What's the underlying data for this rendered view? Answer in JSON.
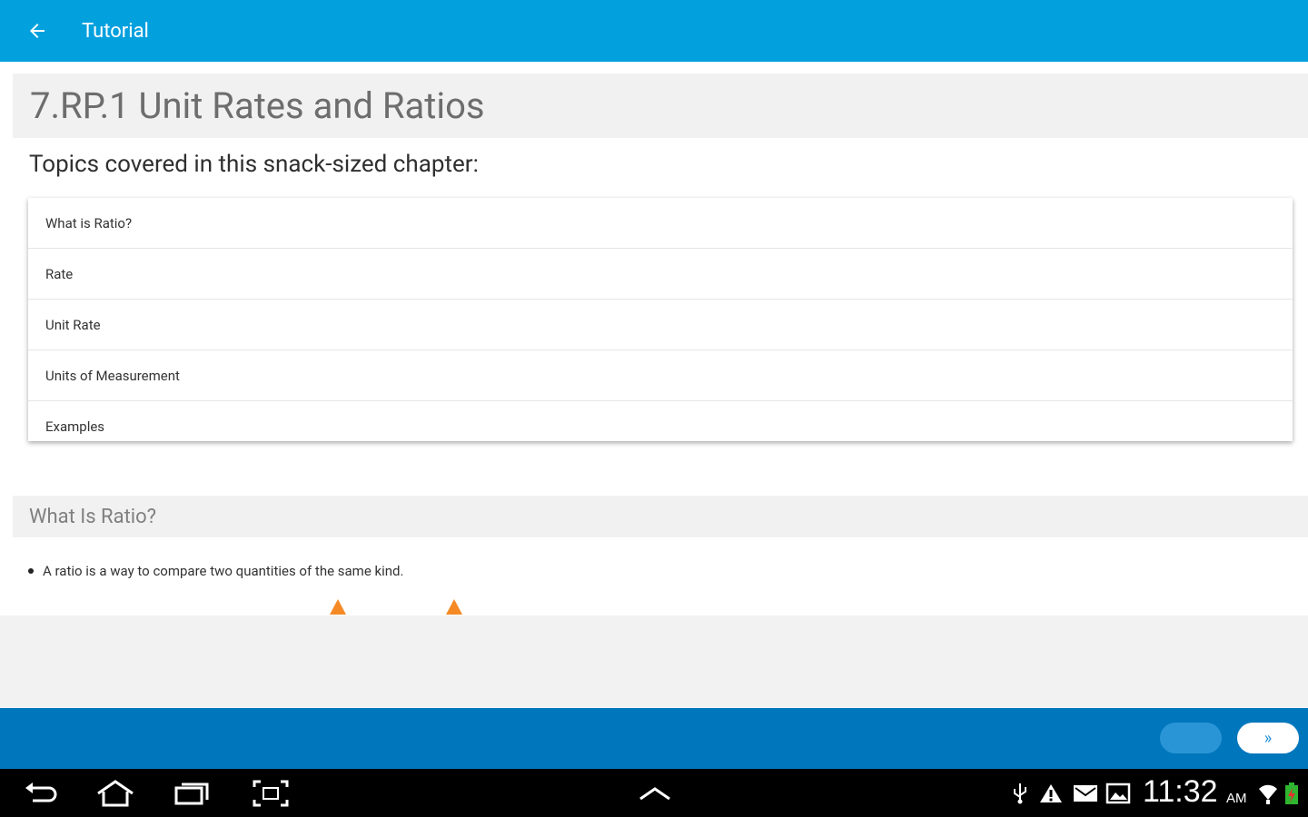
{
  "appbar": {
    "title": "Tutorial",
    "back_icon": "arrow-back-icon",
    "color": "#03a0de"
  },
  "chapter": {
    "title": "7.RP.1 Unit Rates and Ratios"
  },
  "topics": {
    "label": "Topics covered in this snack-sized chapter:",
    "items": [
      "What is Ratio?",
      "Rate",
      "Unit Rate",
      "Units of Measurement",
      "Examples"
    ]
  },
  "section": {
    "title": "What Is Ratio?",
    "bullet": "A ratio is a way to compare two quantities of the same kind."
  },
  "bottombar": {
    "next_label": "»",
    "color": "#0076bc"
  },
  "statusbar": {
    "time": "11:32",
    "ampm": "AM",
    "nav_icons": [
      "back-icon",
      "home-icon",
      "recent-apps-icon",
      "screenshot-icon",
      "chevron-up-icon"
    ],
    "status_icons": [
      "usb-icon",
      "warning-icon",
      "gmail-icon",
      "image-icon",
      "wifi-icon",
      "battery-icon"
    ]
  }
}
